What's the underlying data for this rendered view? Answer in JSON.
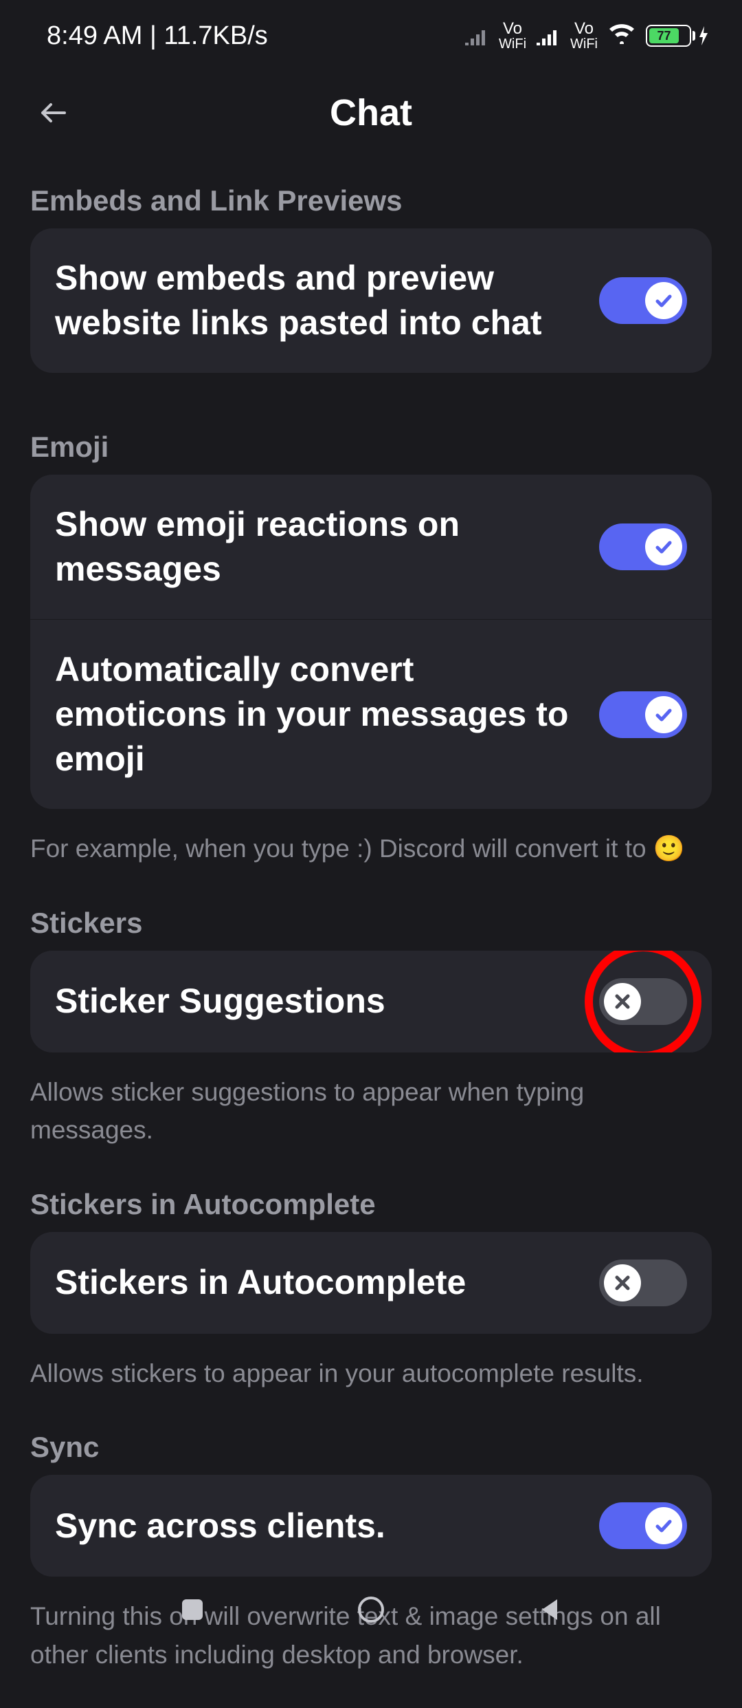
{
  "status": {
    "time": "8:49 AM",
    "data_rate": "11.7KB/s",
    "vo_label_top": "Vo",
    "vo_label_bottom": "WiFi",
    "battery_pct": "77"
  },
  "header": {
    "title": "Chat"
  },
  "sections": {
    "embeds": {
      "header": "Embeds and Link Previews",
      "items": [
        {
          "label": "Show embeds and preview website links pasted into chat",
          "on": true
        }
      ]
    },
    "emoji": {
      "header": "Emoji",
      "items": [
        {
          "label": "Show emoji reactions on messages",
          "on": true
        },
        {
          "label": "Automatically convert emoticons in your messages to emoji",
          "on": true
        }
      ],
      "helper": "For example, when you type :) Discord will convert it to 🙂"
    },
    "stickers": {
      "header": "Stickers",
      "items": [
        {
          "label": "Sticker Suggestions",
          "on": false,
          "highlighted": true
        }
      ],
      "helper": "Allows sticker suggestions to appear when typing messages."
    },
    "stickers_ac": {
      "header": "Stickers in Autocomplete",
      "items": [
        {
          "label": "Stickers in Autocomplete",
          "on": false
        }
      ],
      "helper": "Allows stickers to appear in your autocomplete results."
    },
    "sync": {
      "header": "Sync",
      "items": [
        {
          "label": "Sync across clients.",
          "on": true
        }
      ],
      "helper": "Turning this on will overwrite text & image settings on all other clients including desktop and browser."
    }
  }
}
